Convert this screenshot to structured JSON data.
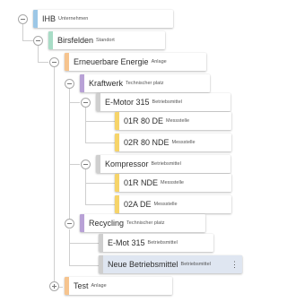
{
  "colors": {
    "unternehmen": "#9cc7e6",
    "standort": "#a8dcc6",
    "anlage": "#f6c48f",
    "technischer_platz": "#b8a1d6",
    "betriebsmittel": "#cfcfcf",
    "messstelle": "#f6d46a",
    "selected_row": "#dfe6f1"
  },
  "tree": {
    "ihb": {
      "name": "IHB",
      "type": "Unternehmen",
      "expanded": true
    },
    "birsfelden": {
      "name": "Birsfelden",
      "type": "Standort",
      "expanded": true
    },
    "erneuerbare": {
      "name": "Erneuerbare Energie",
      "type": "Anlage",
      "expanded": true
    },
    "kraftwerk": {
      "name": "Kraftwerk",
      "type": "Technischer platz",
      "expanded": true
    },
    "emotor315": {
      "name": "E-Motor 315",
      "type": "Betriebsmittel",
      "expanded": true
    },
    "m01r80de": {
      "name": "01R 80 DE",
      "type": "Messstelle"
    },
    "m02r80nde": {
      "name": "02R 80 NDE",
      "type": "Messstelle"
    },
    "kompressor": {
      "name": "Kompressor",
      "type": "Betriebsmittel",
      "expanded": true
    },
    "m01rnde": {
      "name": "01R NDE",
      "type": "Messstelle"
    },
    "m02ade": {
      "name": "02A DE",
      "type": "Messstelle"
    },
    "recycling": {
      "name": "Recycling",
      "type": "Technischer platz",
      "expanded": true
    },
    "emot315": {
      "name": "E-Mot 315",
      "type": "Betriebsmittel"
    },
    "neue": {
      "name": "Neue Betriebsmittel",
      "type": "Betriebsmittel",
      "selected": true,
      "menu_icon": "more-vertical-icon",
      "menu_glyph": "⋮"
    },
    "test": {
      "name": "Test",
      "type": "Anlage",
      "expanded": false
    }
  }
}
